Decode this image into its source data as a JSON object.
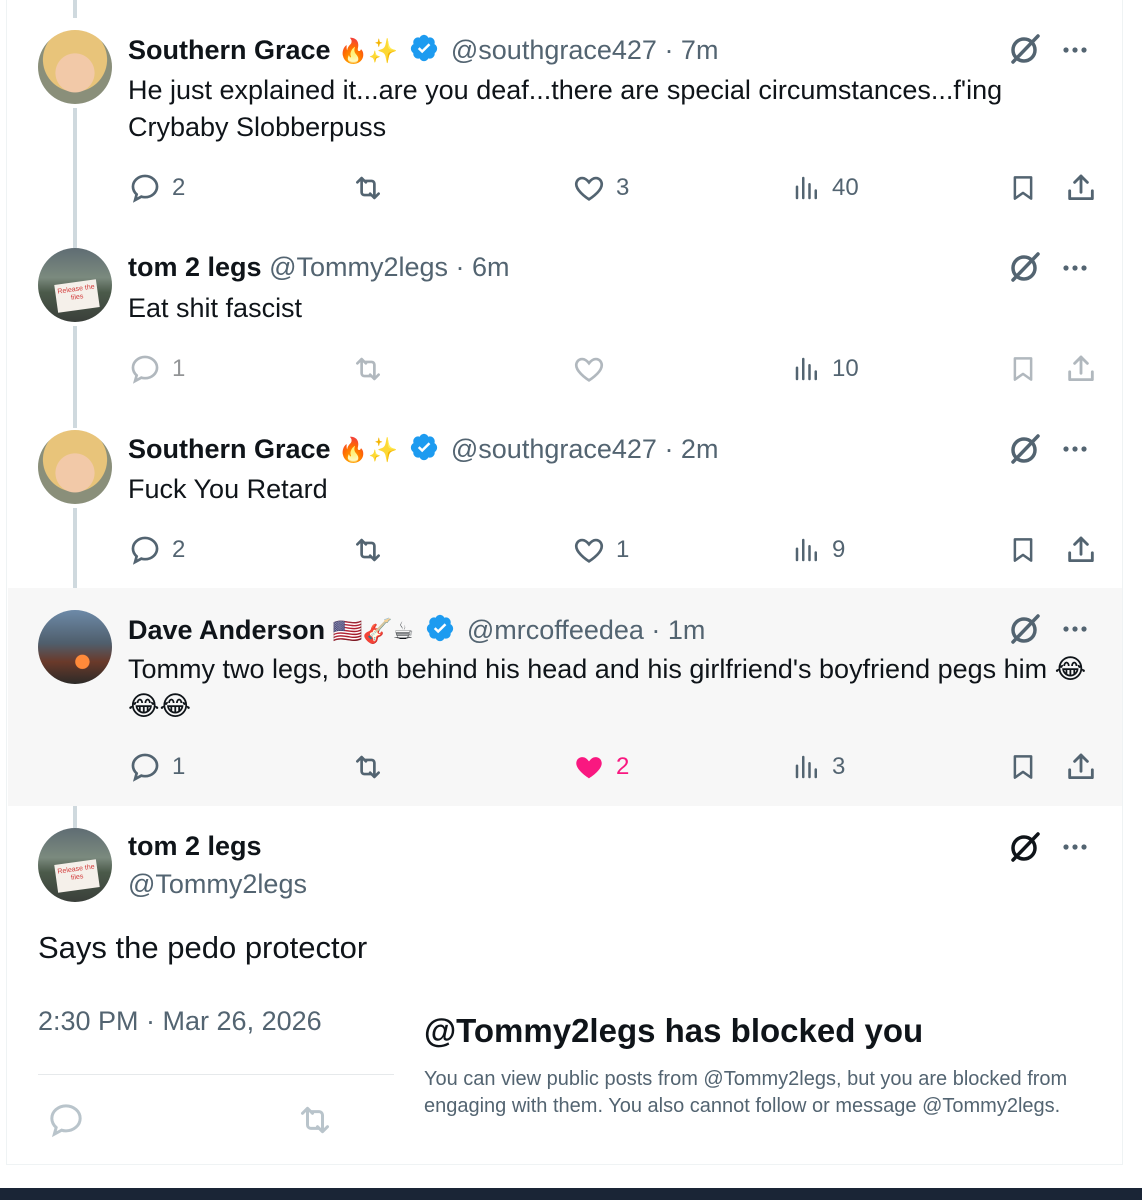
{
  "tweets": [
    {
      "name": "Southern Grace",
      "emojis": "🔥✨",
      "handle": "@southgrace427",
      "time": "· 7m",
      "text": "He just explained it...are you deaf...there are special circumstances...f'ing Crybaby Slobberpuss",
      "replies": "2",
      "likes": "3",
      "views": "40"
    },
    {
      "name": "tom 2 legs",
      "handle": "@Tommy2legs",
      "time": "· 6m",
      "text": "Eat shit fascist",
      "replies": "1",
      "views": "10",
      "avatar_sign": "Release the files"
    },
    {
      "name": "Southern Grace",
      "emojis": "🔥✨",
      "handle": "@southgrace427",
      "time": "· 2m",
      "text": "Fuck You Retard",
      "replies": "2",
      "likes": "1",
      "views": "9"
    },
    {
      "name": "Dave Anderson",
      "emojis": "🇺🇸🎸☕",
      "handle": "@mrcoffeedea",
      "time": "· 1m",
      "text": "Tommy two legs, both behind his head and his girlfriend's boyfriend pegs him 😂😂😂",
      "replies": "1",
      "likes": "2",
      "views": "3"
    }
  ],
  "main_post": {
    "name": "tom 2 legs",
    "handle": "@Tommy2legs",
    "text": "Says the pedo protector",
    "timestamp": "2:30 PM · Mar 26, 2026",
    "avatar_sign": "Release the files"
  },
  "blocked_notice": {
    "title": "@Tommy2legs has blocked you",
    "description": "You can view public posts from @Tommy2legs, but you are blocked from engaging with them. You also cannot follow or message @Tommy2legs."
  },
  "colors": {
    "verified": "#1d9bf0",
    "like_active": "#f91880",
    "secondary_text": "#536471",
    "thread_line": "#cfd9de",
    "highlight_bg": "#f7f7f7"
  },
  "icons": [
    "reply-icon",
    "retweet-icon",
    "like-icon",
    "views-icon",
    "bookmark-icon",
    "share-icon",
    "grok-icon",
    "more-icon",
    "verified-badge-icon"
  ]
}
